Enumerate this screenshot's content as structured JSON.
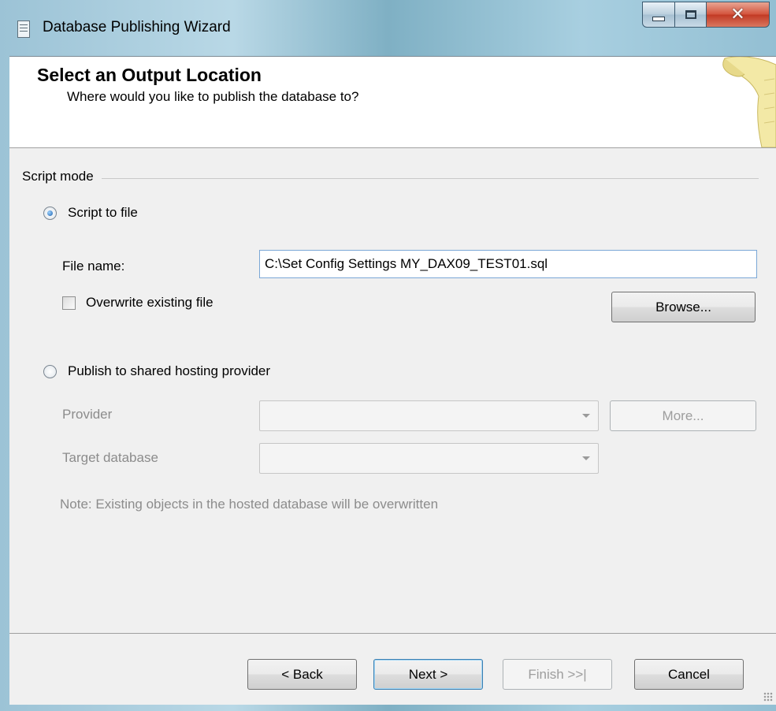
{
  "window": {
    "title": "Database Publishing Wizard"
  },
  "header": {
    "title": "Select an Output Location",
    "subtitle": "Where would you like to publish the database to?"
  },
  "script_mode": {
    "group_label": "Script mode",
    "script_to_file": {
      "label": "Script to file",
      "checked": true
    },
    "file_name_label": "File name:",
    "file_name_value": "C:\\Set Config Settings MY_DAX09_TEST01.sql",
    "overwrite_label": "Overwrite existing file",
    "overwrite_checked": false,
    "browse_label": "Browse...",
    "publish_hosting": {
      "label": "Publish to shared hosting provider",
      "checked": false
    },
    "provider_label": "Provider",
    "more_label": "More...",
    "target_db_label": "Target database",
    "note": "Note: Existing objects in the hosted database will be overwritten"
  },
  "footer": {
    "back_label": "< Back",
    "next_label": "Next >",
    "finish_label": "Finish >>|",
    "cancel_label": "Cancel"
  }
}
